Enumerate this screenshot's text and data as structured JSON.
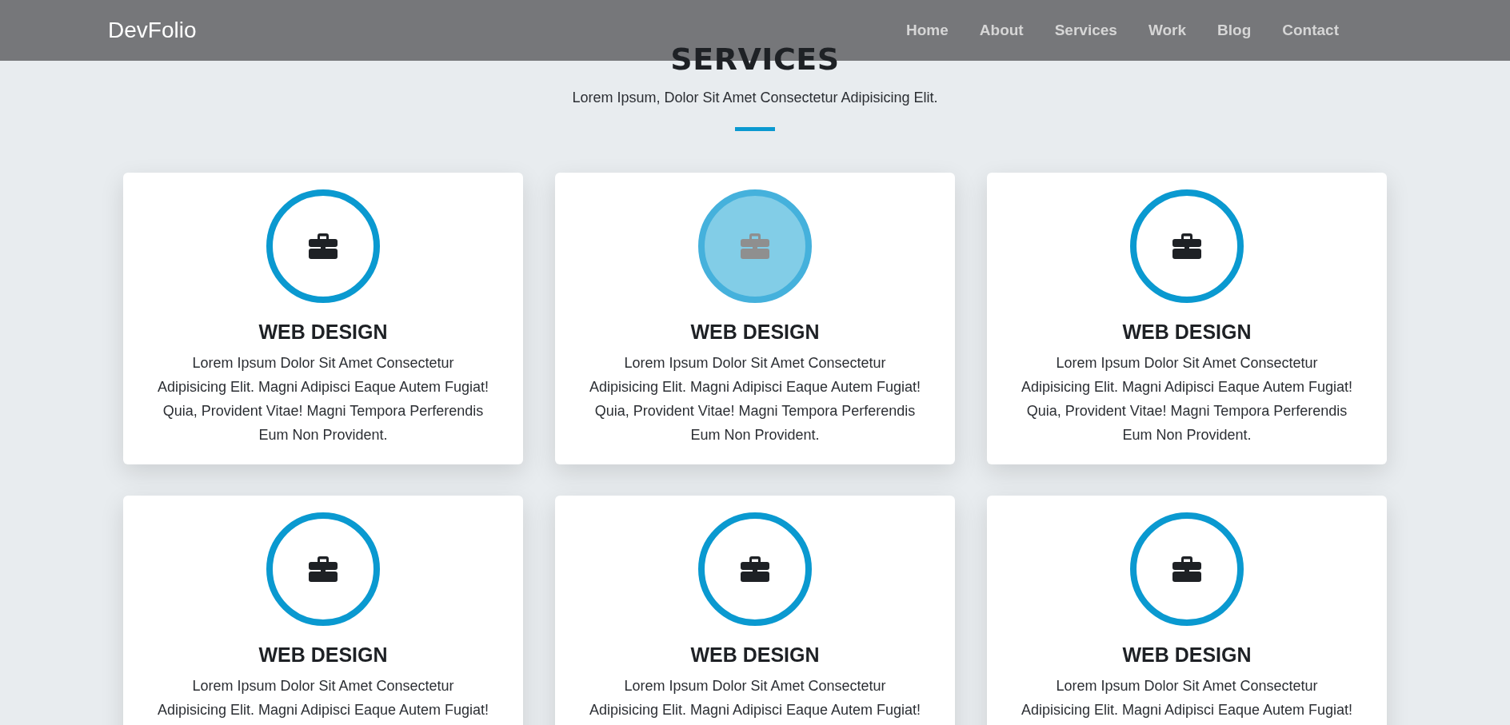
{
  "navbar": {
    "brand": "DevFolio",
    "links": [
      {
        "label": "Home"
      },
      {
        "label": "About"
      },
      {
        "label": "Services"
      },
      {
        "label": "Work"
      },
      {
        "label": "Blog"
      },
      {
        "label": "Contact"
      }
    ]
  },
  "section": {
    "title": "SERVICES",
    "subtitle": "Lorem Ipsum, Dolor Sit Amet Consectetur Adipisicing Elit."
  },
  "cards": [
    {
      "title": "WEB DESIGN",
      "text_lines": [
        "Lorem Ipsum Dolor Sit Amet Consectetur",
        "Adipisicing Elit. Magni Adipisci Eaque Autem Fugiat!",
        "Quia, Provident Vitae! Magni Tempora Perferendis",
        "Eum Non Provident."
      ],
      "highlighted": false
    },
    {
      "title": "WEB DESIGN",
      "text_lines": [
        "Lorem Ipsum Dolor Sit Amet Consectetur",
        "Adipisicing Elit. Magni Adipisci Eaque Autem Fugiat!",
        "Quia, Provident Vitae! Magni Tempora Perferendis",
        "Eum Non Provident."
      ],
      "highlighted": true
    },
    {
      "title": "WEB DESIGN",
      "text_lines": [
        "Lorem Ipsum Dolor Sit Amet Consectetur",
        "Adipisicing Elit. Magni Adipisci Eaque Autem Fugiat!",
        "Quia, Provident Vitae! Magni Tempora Perferendis",
        "Eum Non Provident."
      ],
      "highlighted": false
    },
    {
      "title": "WEB DESIGN",
      "text_lines": [
        "Lorem Ipsum Dolor Sit Amet Consectetur",
        "Adipisicing Elit. Magni Adipisci Eaque Autem Fugiat!"
      ],
      "highlighted": false
    },
    {
      "title": "WEB DESIGN",
      "text_lines": [
        "Lorem Ipsum Dolor Sit Amet Consectetur",
        "Adipisicing Elit. Magni Adipisci Eaque Autem Fugiat!"
      ],
      "highlighted": false
    },
    {
      "title": "WEB DESIGN",
      "text_lines": [
        "Lorem Ipsum Dolor Sit Amet Consectetur",
        "Adipisicing Elit. Magni Adipisci Eaque Autem Fugiat!"
      ],
      "highlighted": false
    }
  ]
}
